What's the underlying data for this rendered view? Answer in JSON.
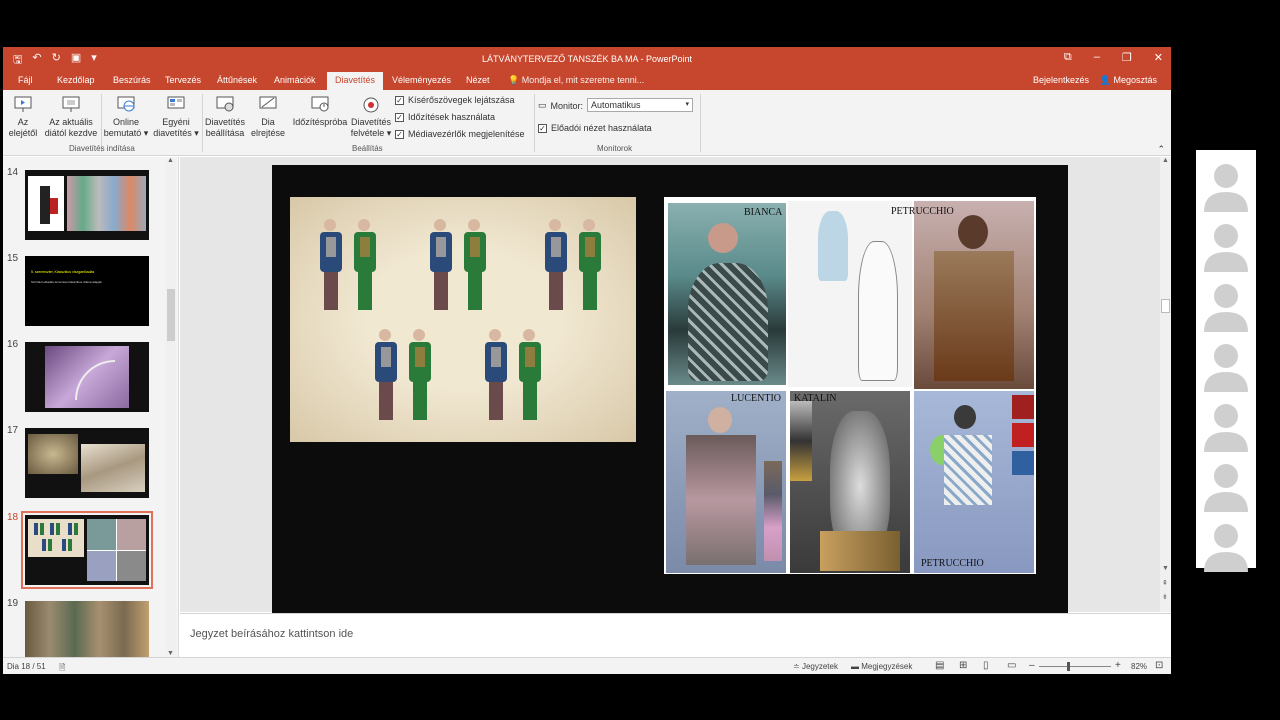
{
  "window": {
    "title": "LÁTVÁNYTERVEZŐ TANSZÉK BA MA - PowerPoint"
  },
  "tabs": {
    "file": "Fájl",
    "home": "Kezdőlap",
    "insert": "Beszúrás",
    "design": "Tervezés",
    "transitions": "Áttűnések",
    "animations": "Animációk",
    "slideshow": "Diavetítés",
    "review": "Véleményezés",
    "view": "Nézet",
    "tell_me": "Mondja el, mit szeretne tenni...",
    "signin": "Bejelentkezés",
    "share": "Megosztás"
  },
  "ribbon": {
    "from_beginning": [
      "Az",
      "elejétől"
    ],
    "from_current": [
      "Az aktuális",
      "diától kezdve"
    ],
    "online": [
      "Online",
      "bemutató ▾"
    ],
    "custom": [
      "Egyéni",
      "diavetítés ▾"
    ],
    "group_start": "Diavetítés indítása",
    "setup": [
      "Diavetítés",
      "beállítása"
    ],
    "hide": [
      "Dia",
      "elrejtése"
    ],
    "rehearse": "Időzítéspróba",
    "record": [
      "Diavetítés",
      "felvétele ▾"
    ],
    "chk_narrations": "Kísérőszövegek lejátszása",
    "chk_timings": "Időzítések használata",
    "chk_media": "Médiavezérlők megjelenítése",
    "group_setup": "Beállítás",
    "monitor_label": "Monitor:",
    "monitor_value": "Automatikus",
    "chk_presenter": "Előadói nézet használata",
    "group_monitors": "Monitorok"
  },
  "thumbnails": [
    {
      "num": "14",
      "selected": false
    },
    {
      "num": "15",
      "selected": false,
      "heading": "5. szemeszter, Klasszikus viszgaelőadás",
      "body": "Színházi előadás tervezése klasszikus dráma alapján"
    },
    {
      "num": "16",
      "selected": false
    },
    {
      "num": "17",
      "selected": false
    },
    {
      "num": "18",
      "selected": true
    },
    {
      "num": "19",
      "selected": false
    }
  ],
  "slide": {
    "labels": {
      "bianca": "BIANCA",
      "petrucchio_top": "PETRUCCHIO",
      "lucentio": "LUCENTIO",
      "katalin": "KATALIN",
      "petrucchio_bottom": "PETRUCCHIO"
    }
  },
  "notes": {
    "placeholder": "Jegyzet beírásához kattintson ide"
  },
  "status": {
    "slide_counter": "Dia 18 / 51",
    "notes": "Jegyzetek",
    "comments": "Megjegyzések",
    "zoom": "82%"
  }
}
